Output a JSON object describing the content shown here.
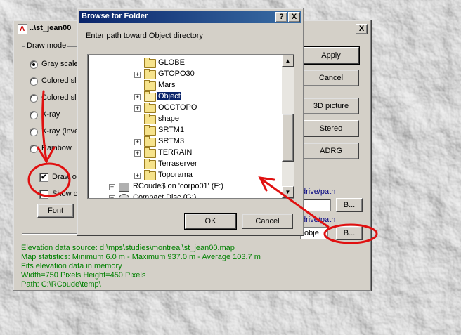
{
  "back_window": {
    "title": "..\\st_jean00",
    "close_label": "X",
    "draw_mode": {
      "legend": "Draw mode",
      "options": [
        {
          "label": "Gray scale",
          "selected": true
        },
        {
          "label": "Colored slo",
          "selected": false
        },
        {
          "label": "Colored slo",
          "selected": false
        },
        {
          "label": "X-ray",
          "selected": false
        },
        {
          "label": "X-ray (inve",
          "selected": false
        },
        {
          "label": "Rainbow",
          "selected": false
        }
      ],
      "checkbox_1": {
        "label": "Draw o",
        "checked": true,
        "check_mark": "✔"
      },
      "checkbox_2": {
        "label": "Show c",
        "checked": false
      },
      "font_button": "Font"
    },
    "buttons": {
      "apply": "Apply",
      "cancel": "Cancel",
      "picture_3d": "3D picture",
      "stereo": "Stereo",
      "adrg": "ADRG",
      "browse_1": "B...",
      "browse_2": "B..."
    },
    "drive_path_label_1": "drive/path",
    "drive_path_label_2": "drive/path",
    "path_field_value": "\\obje",
    "status_lines": [
      "Elevation data source: d:\\mps\\studies\\montreal\\st_jean00.map",
      "Map statistics: Minimum 6.0 m - Maximum 937.0 m - Average 103.7 m",
      "Fits elevation data in memory",
      "Width=750 Pixels  Height=450 Pixels",
      "Path: C:\\RCoude\\temp\\"
    ]
  },
  "dialog": {
    "title": "Browse for Folder",
    "help_label": "?",
    "close_label": "X",
    "prompt": "Enter path toward Object directory",
    "tree_items": [
      {
        "label": "GLOBE",
        "expand": false,
        "icon": "folder",
        "selected": false
      },
      {
        "label": "GTOPO30",
        "expand": true,
        "icon": "folder",
        "selected": false
      },
      {
        "label": "Mars",
        "expand": false,
        "icon": "folder",
        "selected": false
      },
      {
        "label": "Object",
        "expand": true,
        "icon": "folder-open",
        "selected": true
      },
      {
        "label": "OCCTOPO",
        "expand": true,
        "icon": "folder",
        "selected": false
      },
      {
        "label": "shape",
        "expand": false,
        "icon": "folder",
        "selected": false
      },
      {
        "label": "SRTM1",
        "expand": false,
        "icon": "folder",
        "selected": false
      },
      {
        "label": "SRTM3",
        "expand": true,
        "icon": "folder",
        "selected": false
      },
      {
        "label": "TERRAIN",
        "expand": true,
        "icon": "folder",
        "selected": false
      },
      {
        "label": "Terraserver",
        "expand": false,
        "icon": "folder",
        "selected": false
      },
      {
        "label": "Toporama",
        "expand": true,
        "icon": "folder",
        "selected": false
      },
      {
        "label": "RCoude$ on 'corpo01' (F:)",
        "expand": true,
        "icon": "network-drive",
        "selected": false
      },
      {
        "label": "Compact Disc (G:)",
        "expand": true,
        "icon": "cd-drive",
        "selected": false
      }
    ],
    "ok_label": "OK",
    "cancel_label": "Cancel",
    "scroll_up": "▲",
    "scroll_down": "▼",
    "expand_glyph": "+"
  },
  "annotations": {
    "color": "#e01010"
  }
}
